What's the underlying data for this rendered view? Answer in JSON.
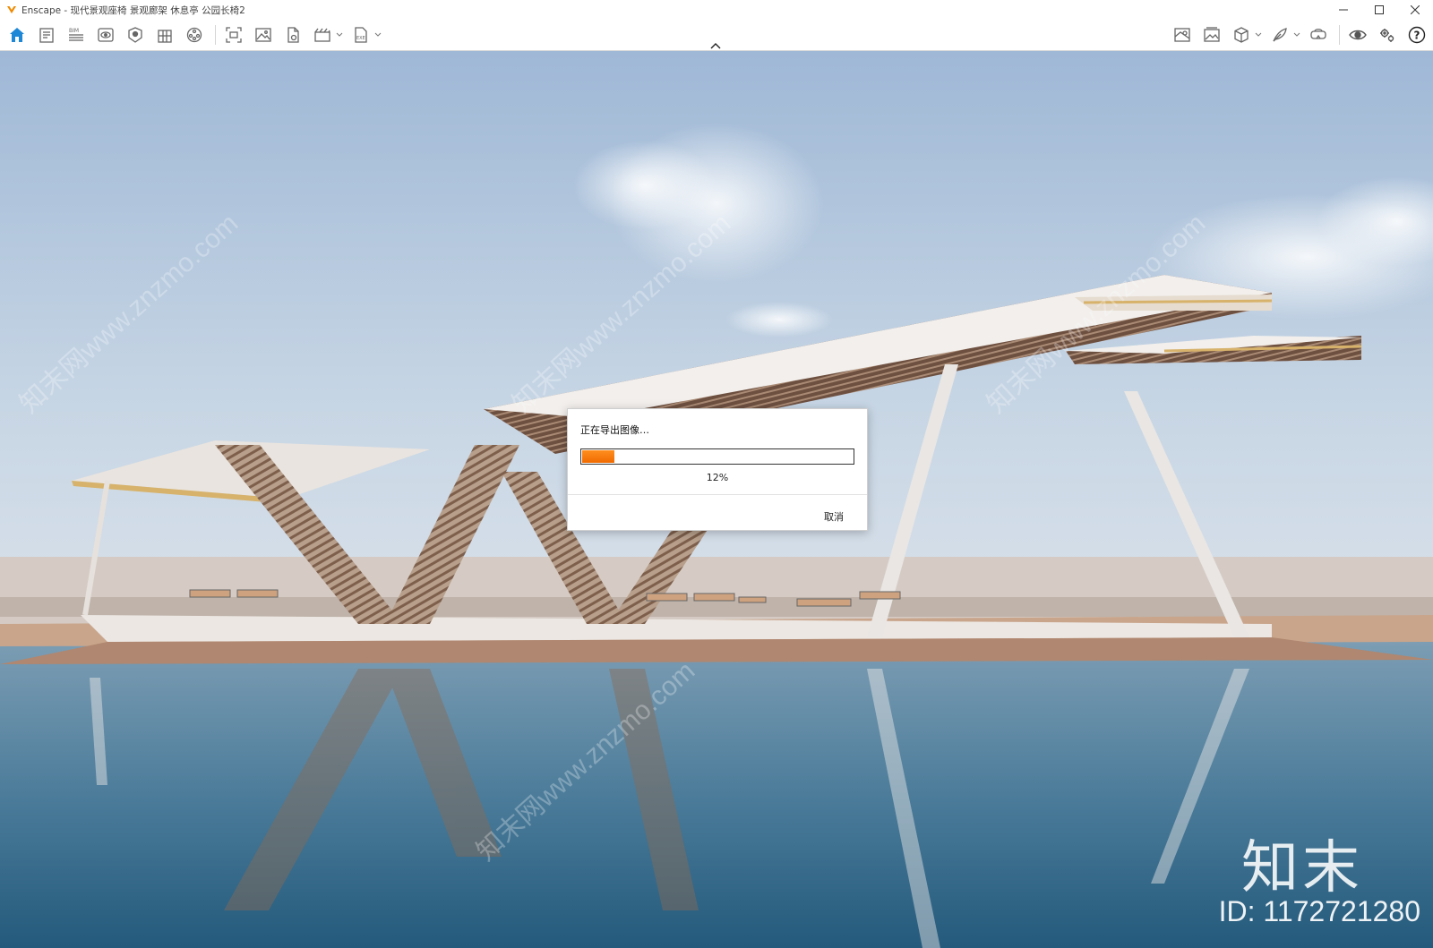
{
  "window": {
    "title": "Enscape - 现代景观座椅 景观廊架 休息亭 公园长椅2",
    "controls": [
      "minimize-icon",
      "maximize-icon",
      "close-icon"
    ]
  },
  "toolbar": {
    "left_icons": [
      "home-icon",
      "document-icon",
      "bim-icon",
      "view-icon",
      "asset-icon",
      "building-icon",
      "material-icon",
      "screenshot-icon",
      "image-icon",
      "export-icon",
      "video-icon",
      "exe-icon"
    ],
    "right_icons": [
      "map-icon",
      "gallery-icon",
      "cube-icon",
      "feather-icon",
      "vr-headset-icon",
      "eye-icon",
      "settings-icon",
      "help-icon"
    ],
    "home_color": "#1e88d6"
  },
  "dialog": {
    "title": "正在导出图像…",
    "progress_percent": 12,
    "progress_label": "12%",
    "cancel_label": "取消",
    "progress_color": "#f57c00"
  },
  "watermark": {
    "brand": "知末",
    "id": "ID: 1172721280",
    "diagonal": "知末网www.znzmo.com"
  }
}
